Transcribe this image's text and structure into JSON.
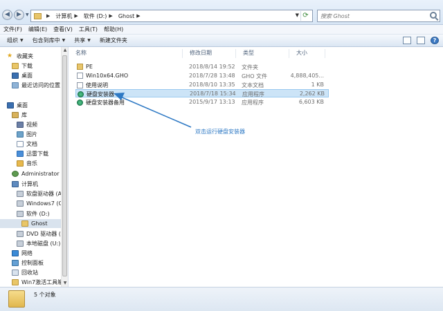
{
  "address": {
    "crumbs": [
      "计算机",
      "软件 (D:)",
      "Ghost"
    ],
    "search_placeholder": "搜索 Ghost"
  },
  "menu": [
    "文件(F)",
    "编辑(E)",
    "查看(V)",
    "工具(T)",
    "帮助(H)"
  ],
  "toolbar": {
    "organize": "组织",
    "include_library": "包含到库中",
    "share": "共享",
    "new_folder": "新建文件夹"
  },
  "sidebar": {
    "items": [
      {
        "label": "收藏夹",
        "icon": "star-icon"
      },
      {
        "label": "下载",
        "icon": "folder-icon"
      },
      {
        "label": "桌面",
        "icon": "desktop-icon"
      },
      {
        "label": "最近访问的位置",
        "icon": "recent-icon"
      },
      {
        "label": "桌面",
        "icon": "desktop-icon"
      },
      {
        "label": "库",
        "icon": "library-icon"
      },
      {
        "label": "视频",
        "icon": "video-icon"
      },
      {
        "label": "图片",
        "icon": "picture-icon"
      },
      {
        "label": "文档",
        "icon": "document-icon"
      },
      {
        "label": "迅雷下载",
        "icon": "thunder-icon"
      },
      {
        "label": "音乐",
        "icon": "music-icon"
      },
      {
        "label": "Administrator",
        "icon": "user-icon"
      },
      {
        "label": "计算机",
        "icon": "computer-icon"
      },
      {
        "label": "软盘驱动器 (A:",
        "icon": "floppy-icon"
      },
      {
        "label": "Windows7 (C:",
        "icon": "drive-icon"
      },
      {
        "label": "软件 (D:)",
        "icon": "drive-icon"
      },
      {
        "label": "Ghost",
        "icon": "folder-icon"
      },
      {
        "label": "DVD 驱动器 (F",
        "icon": "dvd-icon"
      },
      {
        "label": "本地磁盘 (U:)",
        "icon": "drive-icon"
      },
      {
        "label": "网络",
        "icon": "network-icon"
      },
      {
        "label": "控制面板",
        "icon": "control-panel-icon"
      },
      {
        "label": "回收站",
        "icon": "recycle-bin-icon"
      },
      {
        "label": "Win7激活工具箱",
        "icon": "folder-icon"
      }
    ]
  },
  "columns": {
    "name": "名称",
    "date": "修改日期",
    "type": "类型",
    "size": "大小"
  },
  "files": [
    {
      "name": "PE",
      "date": "2018/8/14 19:52",
      "type": "文件夹",
      "size": "",
      "icon": "folder-icon"
    },
    {
      "name": "Win10x64.GHO",
      "date": "2018/7/28 13:48",
      "type": "GHO 文件",
      "size": "4,888,405...",
      "icon": "file-icon"
    },
    {
      "name": "使用说明",
      "date": "2018/8/10 13:35",
      "type": "文本文档",
      "size": "1 KB",
      "icon": "text-file-icon"
    },
    {
      "name": "硬盘安装器",
      "date": "2018/7/18 15:34",
      "type": "应用程序",
      "size": "2,262 KB",
      "icon": "app-icon"
    },
    {
      "name": "硬盘安装器备用",
      "date": "2015/9/17 13:13",
      "type": "应用程序",
      "size": "6,603 KB",
      "icon": "app-icon"
    }
  ],
  "annotation": "双击运行硬盘安装器",
  "status": {
    "count": "5 个对象"
  },
  "colors": {
    "accent": "#2e79c4",
    "highlight": "#cce4f7"
  }
}
